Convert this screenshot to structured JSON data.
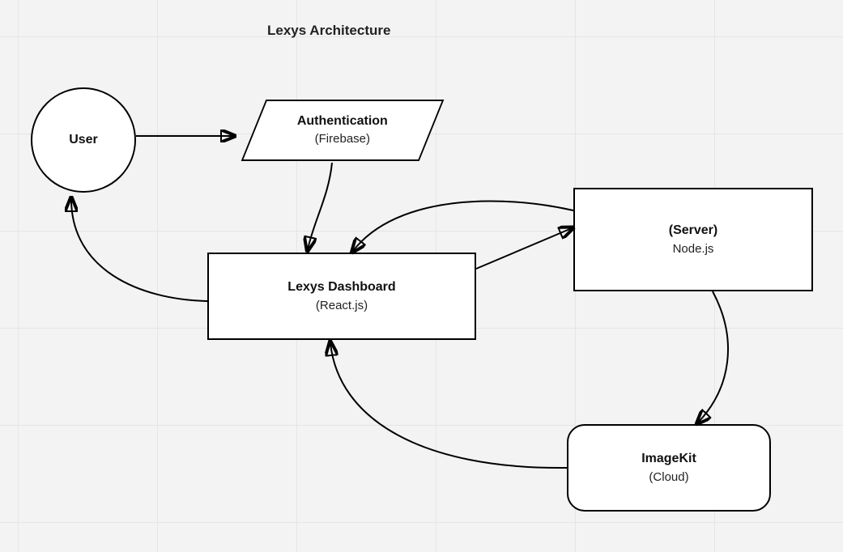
{
  "title": "Lexys Architecture",
  "nodes": {
    "user": {
      "title": "User"
    },
    "auth": {
      "title": "Authentication",
      "subtitle": "(Firebase)"
    },
    "dashboard": {
      "title": "Lexys Dashboard",
      "subtitle": "(React.js)"
    },
    "server": {
      "title": "(Server)",
      "subtitle": "Node.js"
    },
    "imagekit": {
      "title": "ImageKit",
      "subtitle": "(Cloud)"
    }
  },
  "edges": [
    {
      "from": "user",
      "to": "auth"
    },
    {
      "from": "auth",
      "to": "dashboard"
    },
    {
      "from": "dashboard",
      "to": "user"
    },
    {
      "from": "dashboard",
      "to": "server"
    },
    {
      "from": "server",
      "to": "dashboard"
    },
    {
      "from": "server",
      "to": "imagekit"
    },
    {
      "from": "imagekit",
      "to": "dashboard"
    }
  ]
}
